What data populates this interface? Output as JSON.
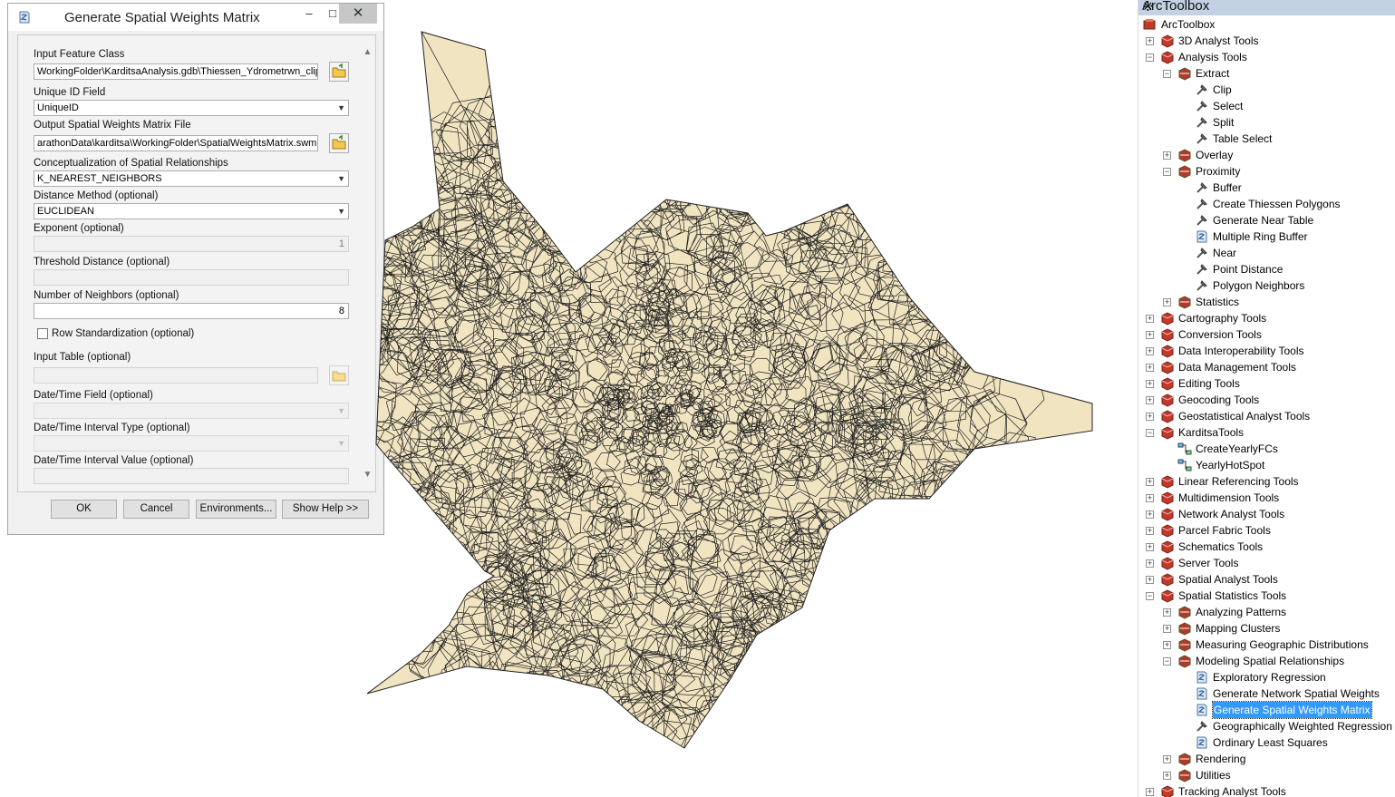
{
  "dialog": {
    "title": "Generate Spatial Weights Matrix",
    "fields": {
      "input_feature_class": {
        "label": "Input Feature Class",
        "value": "WorkingFolder\\KarditsaAnalysis.gdb\\Thiessen_Ydrometrwn_clip"
      },
      "unique_id": {
        "label": "Unique ID Field",
        "value": "UniqueID"
      },
      "output_file": {
        "label": "Output Spatial Weights Matrix File",
        "value": "arathonData\\karditsa\\WorkingFolder\\SpatialWeightsMatrix.swm"
      },
      "conceptualization": {
        "label": "Conceptualization of Spatial Relationships",
        "value": "K_NEAREST_NEIGHBORS"
      },
      "distance_method": {
        "label": "Distance Method (optional)",
        "value": "EUCLIDEAN"
      },
      "exponent": {
        "label": "Exponent (optional)",
        "value": "1"
      },
      "threshold": {
        "label": "Threshold Distance (optional)",
        "value": ""
      },
      "neighbors": {
        "label": "Number of Neighbors (optional)",
        "value": "8"
      },
      "row_std": {
        "label": "Row Standardization (optional)"
      },
      "input_table": {
        "label": "Input Table (optional)",
        "value": ""
      },
      "datetime_field": {
        "label": "Date/Time Field (optional)"
      },
      "datetime_type": {
        "label": "Date/Time Interval Type (optional)"
      },
      "datetime_value": {
        "label": "Date/Time Interval Value (optional)"
      }
    },
    "buttons": {
      "ok": "OK",
      "cancel": "Cancel",
      "environments": "Environments...",
      "help": "Show Help >>"
    }
  },
  "toolbox": {
    "title": "ArcToolbox",
    "items": [
      {
        "label": "ArcToolbox",
        "level": 0,
        "exp": "",
        "icon": "toolbox-root"
      },
      {
        "label": "3D Analyst Tools",
        "level": 1,
        "exp": "+",
        "icon": "toolbox"
      },
      {
        "label": "Analysis Tools",
        "level": 1,
        "exp": "-",
        "icon": "toolbox"
      },
      {
        "label": "Extract",
        "level": 2,
        "exp": "-",
        "icon": "toolset"
      },
      {
        "label": "Clip",
        "level": 3,
        "exp": "",
        "icon": "tool"
      },
      {
        "label": "Select",
        "level": 3,
        "exp": "",
        "icon": "tool"
      },
      {
        "label": "Split",
        "level": 3,
        "exp": "",
        "icon": "tool"
      },
      {
        "label": "Table Select",
        "level": 3,
        "exp": "",
        "icon": "tool"
      },
      {
        "label": "Overlay",
        "level": 2,
        "exp": "+",
        "icon": "toolset"
      },
      {
        "label": "Proximity",
        "level": 2,
        "exp": "-",
        "icon": "toolset"
      },
      {
        "label": "Buffer",
        "level": 3,
        "exp": "",
        "icon": "tool"
      },
      {
        "label": "Create Thiessen Polygons",
        "level": 3,
        "exp": "",
        "icon": "tool"
      },
      {
        "label": "Generate Near Table",
        "level": 3,
        "exp": "",
        "icon": "tool"
      },
      {
        "label": "Multiple Ring Buffer",
        "level": 3,
        "exp": "",
        "icon": "script"
      },
      {
        "label": "Near",
        "level": 3,
        "exp": "",
        "icon": "tool"
      },
      {
        "label": "Point Distance",
        "level": 3,
        "exp": "",
        "icon": "tool"
      },
      {
        "label": "Polygon Neighbors",
        "level": 3,
        "exp": "",
        "icon": "tool"
      },
      {
        "label": "Statistics",
        "level": 2,
        "exp": "+",
        "icon": "toolset"
      },
      {
        "label": "Cartography Tools",
        "level": 1,
        "exp": "+",
        "icon": "toolbox"
      },
      {
        "label": "Conversion Tools",
        "level": 1,
        "exp": "+",
        "icon": "toolbox"
      },
      {
        "label": "Data Interoperability Tools",
        "level": 1,
        "exp": "+",
        "icon": "toolbox"
      },
      {
        "label": "Data Management Tools",
        "level": 1,
        "exp": "+",
        "icon": "toolbox"
      },
      {
        "label": "Editing Tools",
        "level": 1,
        "exp": "+",
        "icon": "toolbox"
      },
      {
        "label": "Geocoding Tools",
        "level": 1,
        "exp": "+",
        "icon": "toolbox"
      },
      {
        "label": "Geostatistical Analyst Tools",
        "level": 1,
        "exp": "+",
        "icon": "toolbox"
      },
      {
        "label": "KarditsaTools",
        "level": 1,
        "exp": "-",
        "icon": "toolbox"
      },
      {
        "label": "CreateYearlyFCs",
        "level": 2,
        "exp": "",
        "icon": "model"
      },
      {
        "label": "YearlyHotSpot",
        "level": 2,
        "exp": "",
        "icon": "model"
      },
      {
        "label": "Linear Referencing Tools",
        "level": 1,
        "exp": "+",
        "icon": "toolbox"
      },
      {
        "label": "Multidimension Tools",
        "level": 1,
        "exp": "+",
        "icon": "toolbox"
      },
      {
        "label": "Network Analyst Tools",
        "level": 1,
        "exp": "+",
        "icon": "toolbox"
      },
      {
        "label": "Parcel Fabric Tools",
        "level": 1,
        "exp": "+",
        "icon": "toolbox"
      },
      {
        "label": "Schematics Tools",
        "level": 1,
        "exp": "+",
        "icon": "toolbox"
      },
      {
        "label": "Server Tools",
        "level": 1,
        "exp": "+",
        "icon": "toolbox"
      },
      {
        "label": "Spatial Analyst Tools",
        "level": 1,
        "exp": "+",
        "icon": "toolbox"
      },
      {
        "label": "Spatial Statistics Tools",
        "level": 1,
        "exp": "-",
        "icon": "toolbox"
      },
      {
        "label": "Analyzing Patterns",
        "level": 2,
        "exp": "+",
        "icon": "toolset"
      },
      {
        "label": "Mapping Clusters",
        "level": 2,
        "exp": "+",
        "icon": "toolset"
      },
      {
        "label": "Measuring Geographic Distributions",
        "level": 2,
        "exp": "+",
        "icon": "toolset"
      },
      {
        "label": "Modeling Spatial Relationships",
        "level": 2,
        "exp": "-",
        "icon": "toolset"
      },
      {
        "label": "Exploratory Regression",
        "level": 3,
        "exp": "",
        "icon": "script"
      },
      {
        "label": "Generate Network Spatial Weights",
        "level": 3,
        "exp": "",
        "icon": "script"
      },
      {
        "label": "Generate Spatial Weights Matrix",
        "level": 3,
        "exp": "",
        "icon": "script",
        "selected": true
      },
      {
        "label": "Geographically Weighted Regression",
        "level": 3,
        "exp": "",
        "icon": "tool"
      },
      {
        "label": "Ordinary Least Squares",
        "level": 3,
        "exp": "",
        "icon": "script"
      },
      {
        "label": "Rendering",
        "level": 2,
        "exp": "+",
        "icon": "toolset"
      },
      {
        "label": "Utilities",
        "level": 2,
        "exp": "+",
        "icon": "toolset"
      },
      {
        "label": "Tracking Analyst Tools",
        "level": 1,
        "exp": "+",
        "icon": "toolbox"
      }
    ]
  },
  "colors": {
    "polygon_fill": "#f1e4c1",
    "polygon_stroke": "#222222",
    "selection": "#3399ff",
    "toolbox_red": "#c0392b"
  }
}
